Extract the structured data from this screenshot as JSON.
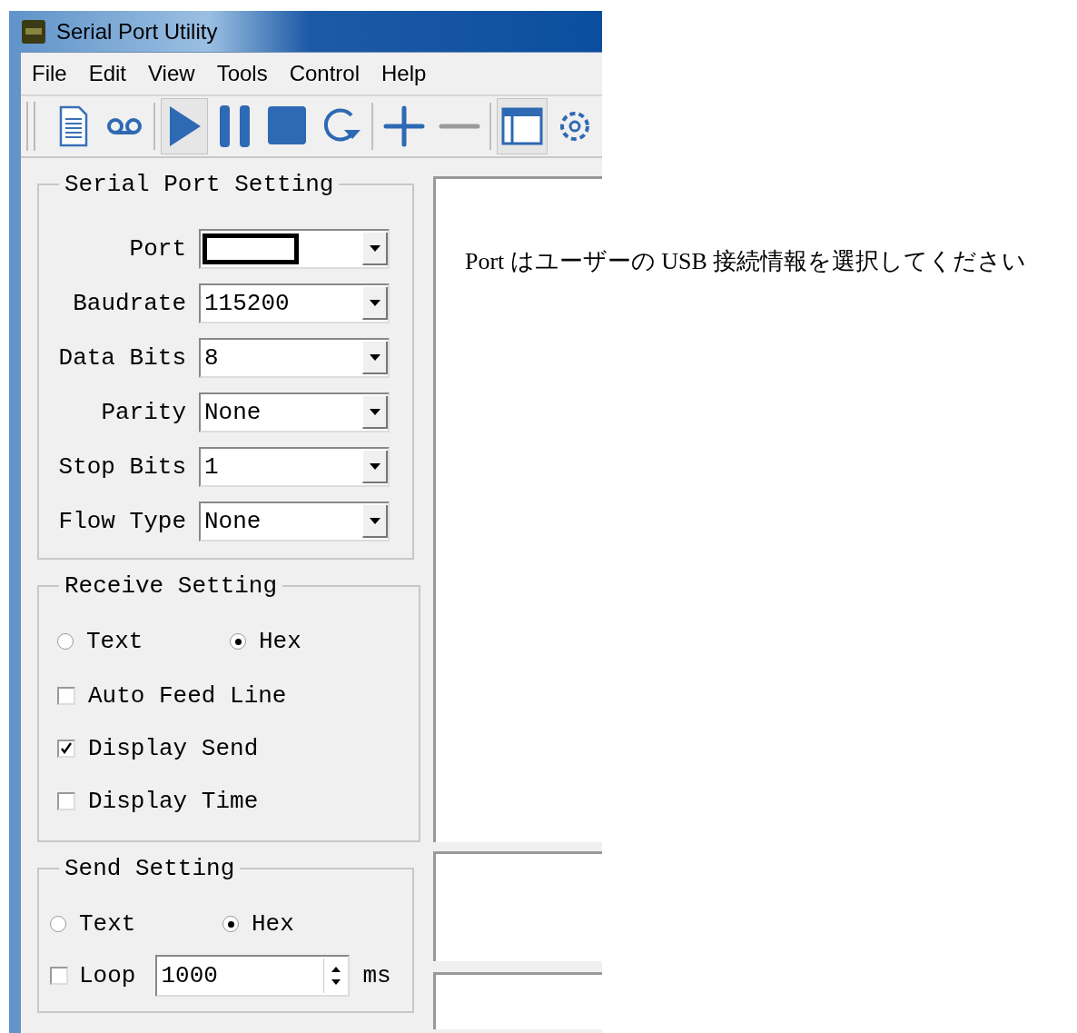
{
  "window": {
    "title": "Serial Port Utility"
  },
  "menu": [
    {
      "label": "File"
    },
    {
      "label": "Edit"
    },
    {
      "label": "View"
    },
    {
      "label": "Tools"
    },
    {
      "label": "Control"
    },
    {
      "label": "Help"
    }
  ],
  "toolbar": {
    "play_checked": true,
    "remove_disabled": true,
    "layout_checked": true
  },
  "serial_port_setting": {
    "title": "Serial Port Setting",
    "fields": [
      {
        "label": "Port",
        "redacted": true
      },
      {
        "label": "Baudrate",
        "value": "115200",
        "redacted": false
      },
      {
        "label": "Data Bits",
        "value": "8",
        "redacted": false
      },
      {
        "label": "Parity",
        "value": "None",
        "redacted": false
      },
      {
        "label": "Stop Bits",
        "value": "1",
        "redacted": false
      },
      {
        "label": "Flow Type",
        "value": "None",
        "redacted": false
      }
    ]
  },
  "receive_setting": {
    "title": "Receive Setting",
    "modes": [
      {
        "label": "Text",
        "selected": false
      },
      {
        "label": "Hex",
        "selected": true
      }
    ],
    "options": [
      {
        "label": "Auto Feed Line",
        "checked": false
      },
      {
        "label": "Display Send",
        "checked": true
      },
      {
        "label": "Display Time",
        "checked": false
      }
    ]
  },
  "send_setting": {
    "title": "Send Setting",
    "modes": [
      {
        "label": "Text",
        "selected": false
      },
      {
        "label": "Hex",
        "selected": true
      }
    ],
    "loop": {
      "label": "Loop",
      "checked": false
    },
    "interval": {
      "value": "1000",
      "unit": "ms"
    }
  },
  "note": "Port はユーザーの USB 接続情報を選択してください"
}
